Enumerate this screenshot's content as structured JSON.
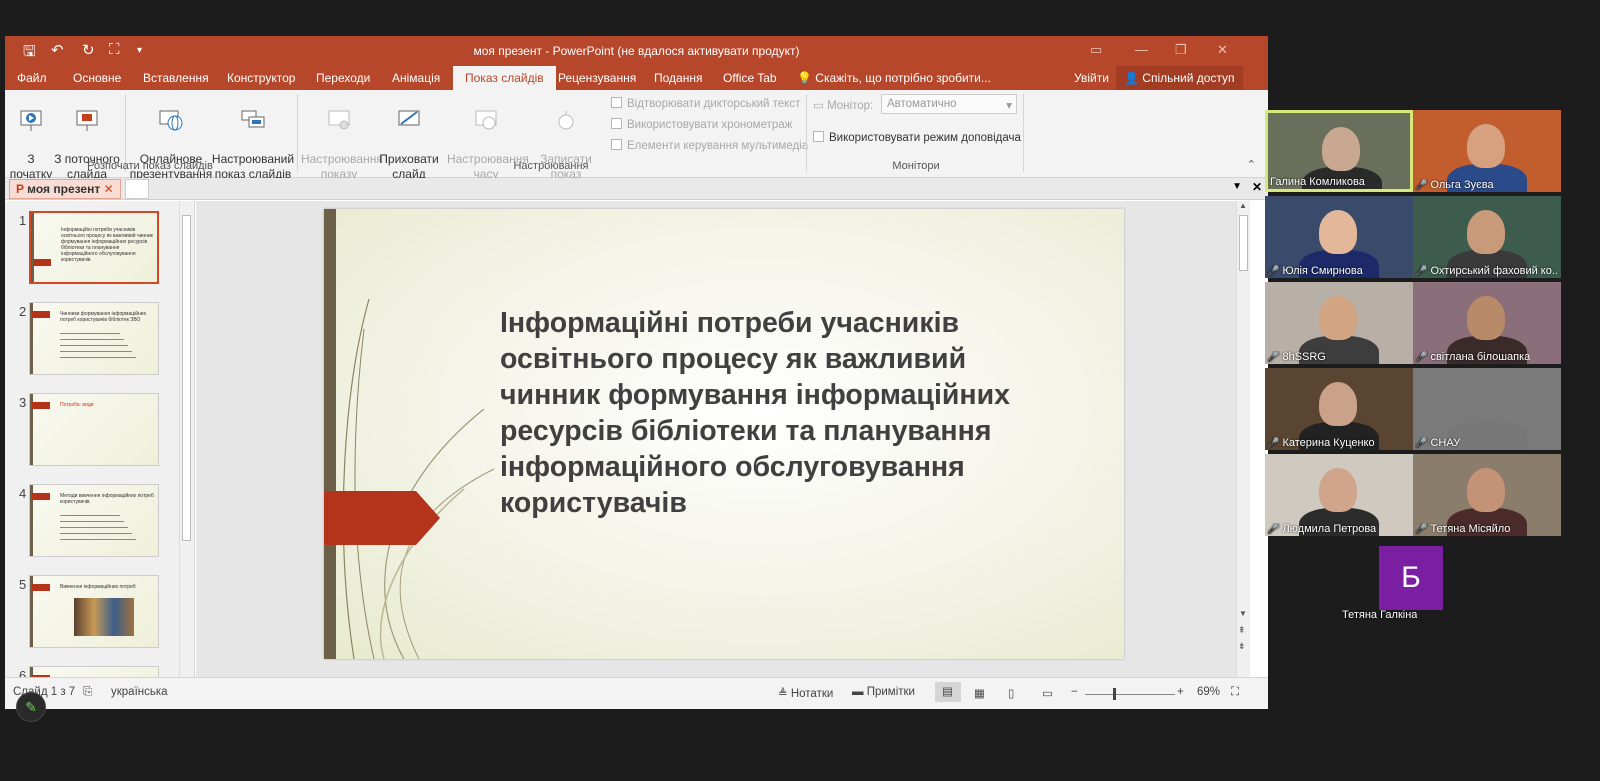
{
  "window": {
    "title": "моя презент - PowerPoint (не вдалося активувати продукт)"
  },
  "tabs": [
    "Файл",
    "Основне",
    "Вставлення",
    "Конструктор",
    "Переходи",
    "Анімація",
    "Показ слайдів",
    "Рецензування",
    "Подання",
    "Office Tab"
  ],
  "tell_me": "Скажіть, що потрібно зробити...",
  "signin": "Увійти",
  "share": "Спільний доступ",
  "ribbon": {
    "from_start": "З\nпочатку",
    "from_current": "З поточного\nслайда",
    "online": "Онлайнове\nпрезентування ▾",
    "custom": "Настроюваний\nпоказ слайдів ▾",
    "group_start": "Розпочати показ слайдів",
    "setup": "Настроювання\nпоказу слайдів",
    "hide": "Приховати\nслайд",
    "rehearse": "Настроювання\nчасу",
    "record": "Записати показ\nслайдів ▾",
    "play_narr": "Відтворювати дикторський текст",
    "use_timings": "Використовувати хронометраж",
    "media_controls": "Елементи керування мультимедіа",
    "group_setup": "Настроювання",
    "monitor_label": "Монітор:",
    "monitor_value": "Автоматично",
    "presenter_view": "Використовувати режим доповідача",
    "group_monitors": "Монітори"
  },
  "doc_tab": "моя презент",
  "thumbs": [
    {
      "n": "1",
      "title": "Інформаційні потреби учасників освітнього процесу як важливий чинник формування інформаційних ресурсів бібліотеки та планування інформаційного обслуговування користувачів"
    },
    {
      "n": "2",
      "title": "Чинники формування інформаційних потреб користувачів бібліотек ЗВО"
    },
    {
      "n": "3",
      "title": "Потреба: види"
    },
    {
      "n": "4",
      "title": "Методи вивчення інформаційних потреб користувачів"
    },
    {
      "n": "5",
      "title": "Вивчення інформаційних потреб"
    },
    {
      "n": "6",
      "title": ""
    }
  ],
  "slide": {
    "title": "Інформаційні потреби учасників\nосвітнього процесу як важливий\nчинник формування інформаційних\nресурсів бібліотеки та планування\nінформаційного обслуговування\nкористувачів"
  },
  "status": {
    "slide_info": "Слайд 1 з 7",
    "language": "українська",
    "notes": "Нотатки",
    "comments": "Примітки",
    "zoom": "69%"
  },
  "participants": [
    {
      "name": "Галина Комликова",
      "muted": false
    },
    {
      "name": "Ольга Зуєва",
      "muted": true
    },
    {
      "name": "Юлія Смирнова",
      "muted": true
    },
    {
      "name": "Охтирський фаховий ко...",
      "muted": true
    },
    {
      "name": "8hSSRG",
      "muted": true
    },
    {
      "name": "світлана білошапка",
      "muted": true
    },
    {
      "name": "Катерина Куценко",
      "muted": true
    },
    {
      "name": "СНАУ",
      "muted": true
    },
    {
      "name": "Людмила Петрова",
      "muted": true
    },
    {
      "name": "Тетяна Місяйло",
      "muted": true
    },
    {
      "name": "Тетяна Галкіна",
      "muted": false,
      "avatar": "Б"
    }
  ],
  "colors": {
    "accent": "#b7472a",
    "active_speaker": "#d6e87a",
    "avatar_bg": "#7b1fa2"
  }
}
